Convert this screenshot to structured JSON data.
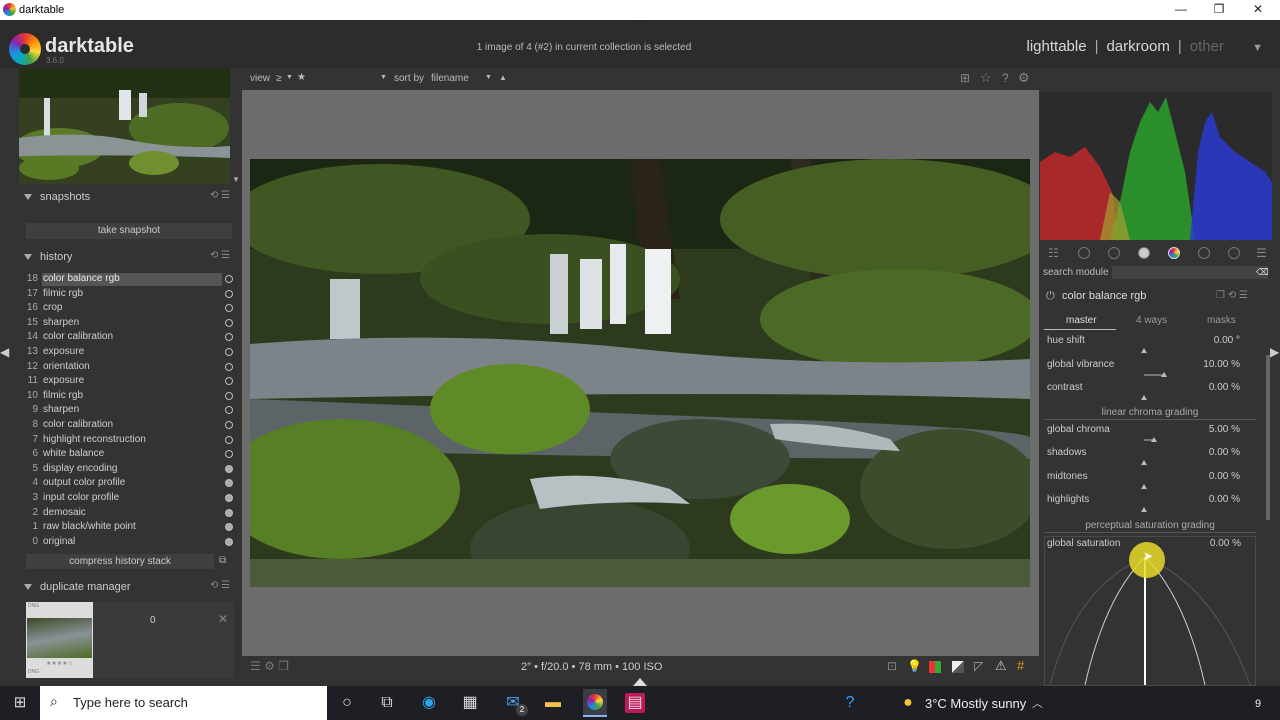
{
  "window": {
    "title": "darktable",
    "controls": [
      "—",
      "❐",
      "✕"
    ]
  },
  "header": {
    "brand": "darktable",
    "version": "3.6.0",
    "info": "1 image of 4 (#2) in current collection is selected",
    "views": {
      "lighttable": "lighttable",
      "sep1": "|",
      "darkroom": "darkroom",
      "sep2": "|",
      "other": "other"
    }
  },
  "topbar": {
    "view_label": "view",
    "view_op": "≥",
    "view_star": "★",
    "sort_label": "sort by",
    "sort_value": "filename"
  },
  "snapshots": {
    "title": "snapshots",
    "take": "take snapshot"
  },
  "history": {
    "title": "history",
    "items": [
      {
        "n": "18",
        "label": "color balance rgb"
      },
      {
        "n": "17",
        "label": "filmic rgb"
      },
      {
        "n": "16",
        "label": "crop"
      },
      {
        "n": "15",
        "label": "sharpen"
      },
      {
        "n": "14",
        "label": "color calibration"
      },
      {
        "n": "13",
        "label": "exposure"
      },
      {
        "n": "12",
        "label": "orientation"
      },
      {
        "n": "11",
        "label": "exposure"
      },
      {
        "n": "10",
        "label": "filmic rgb"
      },
      {
        "n": "9",
        "label": "sharpen"
      },
      {
        "n": "8",
        "label": "color calibration"
      },
      {
        "n": "7",
        "label": "highlight reconstruction"
      },
      {
        "n": "6",
        "label": "white balance"
      },
      {
        "n": "5",
        "label": "display encoding"
      },
      {
        "n": "4",
        "label": "output color profile"
      },
      {
        "n": "3",
        "label": "input color profile"
      },
      {
        "n": "2",
        "label": "demosaic"
      },
      {
        "n": "1",
        "label": "raw black/white point"
      },
      {
        "n": "0",
        "label": "original"
      }
    ],
    "compress": "compress history stack"
  },
  "duplicate": {
    "title": "duplicate manager",
    "count": "0",
    "dng_top": "DNG",
    "dng_bottom": "DNG"
  },
  "bottombar": {
    "exif": "2″ • f/20.0 • 78 mm • 100 ISO"
  },
  "right": {
    "search_label": "search module",
    "module_title": "color balance rgb",
    "tabs": {
      "master": "master",
      "ways": "4 ways",
      "masks": "masks"
    },
    "sliders": [
      {
        "key": "hue shift",
        "value": "0.00 °",
        "pos": 0.5
      },
      {
        "key": "global vibrance",
        "value": "10.00 %",
        "pos": 0.6
      },
      {
        "key": "contrast",
        "value": "0.00 %",
        "pos": 0.5
      }
    ],
    "section1": "linear chroma grading",
    "chroma": [
      {
        "key": "global chroma",
        "value": "5.00 %",
        "pos": 0.55
      },
      {
        "key": "shadows",
        "value": "0.00 %",
        "pos": 0.5
      },
      {
        "key": "midtones",
        "value": "0.00 %",
        "pos": 0.5
      },
      {
        "key": "highlights",
        "value": "0.00 %",
        "pos": 0.5
      }
    ],
    "section2": "perceptual saturation grading",
    "saturation": {
      "key": "global saturation",
      "value": "0.00 %"
    }
  },
  "taskbar": {
    "search_placeholder": "Type here to search",
    "weather": "3°C  Mostly sunny",
    "mail_badge": "2",
    "tray_num": "9"
  }
}
